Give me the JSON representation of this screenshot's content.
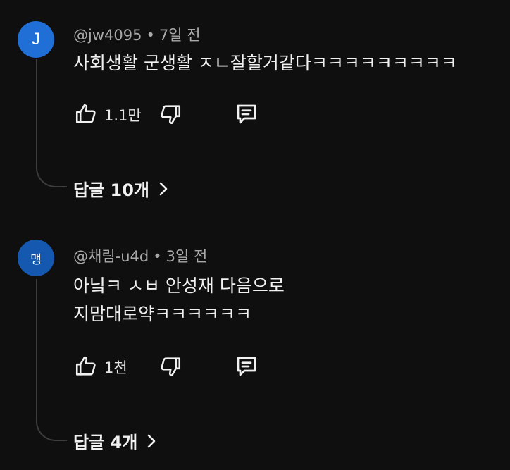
{
  "comments": [
    {
      "avatar_letter": "J",
      "avatar_color": "#1f6fd6",
      "author": "@jw4095",
      "separator": "•",
      "time": "7일 전",
      "lines": [
        "사회생활 군생활 ㅈㄴ잘할거같다ㅋㅋㅋㅋㅋㅋㅋㅋㅋ"
      ],
      "likes": "1.1만",
      "replies_label": "답글 10개",
      "icons": {
        "like": "thumbs-up-icon",
        "dislike": "thumbs-down-icon",
        "reply": "comment-icon",
        "chevron": "chevron-right-icon"
      }
    },
    {
      "avatar_letter": "맹",
      "avatar_color": "#1558b0",
      "author": "@채림-u4d",
      "separator": "•",
      "time": "3일 전",
      "lines": [
        "아닠ㅋ ㅅㅂ 안성재 다음으로",
        "지맘대로약ㅋㅋㅋㅋㅋㅋ"
      ],
      "likes": "1천",
      "replies_label": "답글 4개",
      "icons": {
        "like": "thumbs-up-icon",
        "dislike": "thumbs-down-icon",
        "reply": "comment-icon",
        "chevron": "chevron-right-icon"
      }
    }
  ]
}
